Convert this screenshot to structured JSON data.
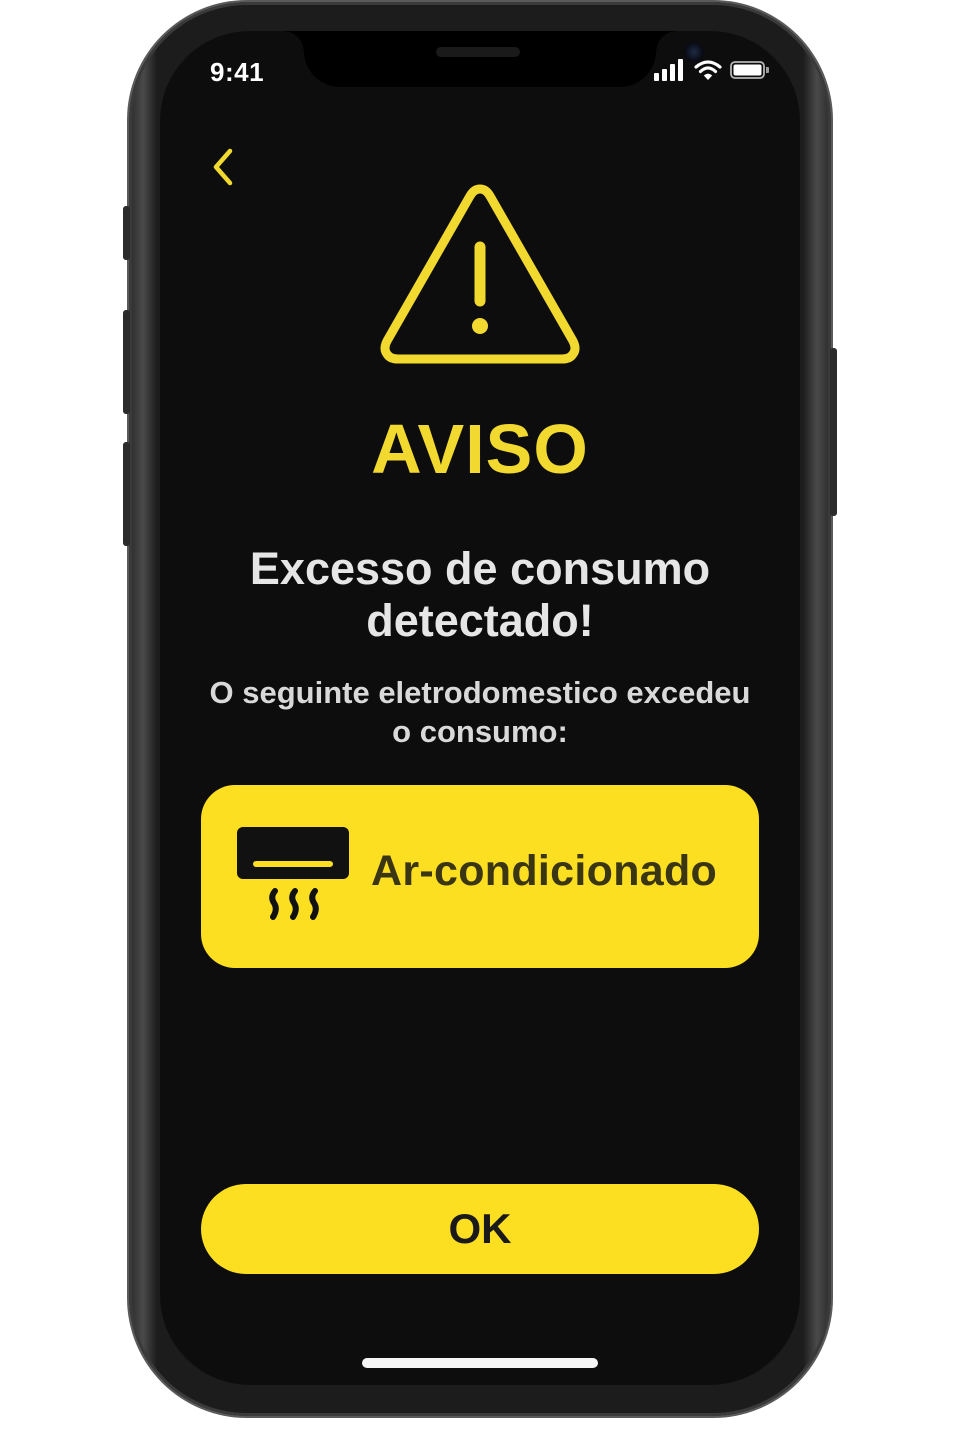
{
  "status_bar": {
    "time": "9:41",
    "icons": [
      "cellular-signal-icon",
      "wifi-icon",
      "battery-icon"
    ]
  },
  "nav": {
    "back_icon": "chevron-left-icon"
  },
  "alert": {
    "icon": "warning-triangle-icon",
    "title": "AVISO",
    "headline": "Excesso de consumo detectado!",
    "message": "O seguinte eletrodomestico excedeu o consumo:"
  },
  "appliance": {
    "icon": "air-conditioner-icon",
    "name": "Ar-condicionado"
  },
  "actions": {
    "ok_label": "OK"
  },
  "colors": {
    "accent": "#fddf22",
    "title_yellow": "#f2d930",
    "background": "#0d0d0d",
    "text_light": "#e6e6e6"
  }
}
